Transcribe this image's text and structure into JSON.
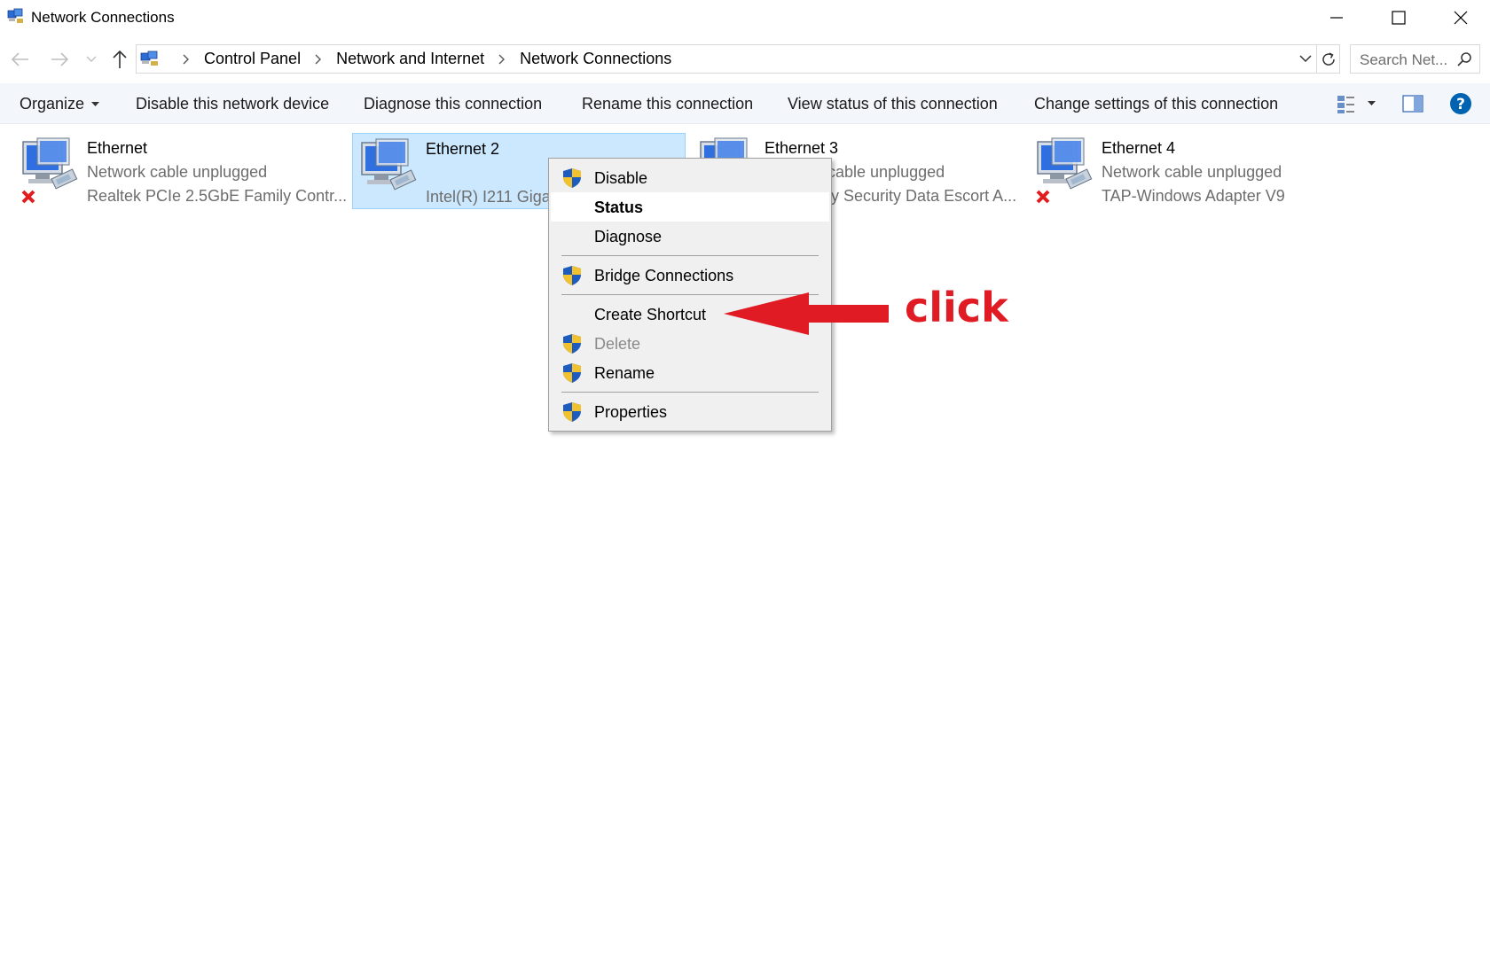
{
  "window": {
    "title": "Network Connections"
  },
  "address": {
    "breadcrumbs": [
      "Control Panel",
      "Network and Internet",
      "Network Connections"
    ],
    "search_placeholder": "Search Net..."
  },
  "commandbar": {
    "organize": "Organize",
    "disable": "Disable this network device",
    "diagnose": "Diagnose this connection",
    "rename": "Rename this connection",
    "view_status": "View status of this connection",
    "change_settings": "Change settings of this connection"
  },
  "connections": [
    {
      "name": "Ethernet",
      "status": "Network cable unplugged",
      "device": "Realtek PCIe 2.5GbE Family Contr...",
      "unplugged": true,
      "selected": false
    },
    {
      "name": "Ethernet 2",
      "status": "",
      "device": "Intel(R) I211 Gigabit Network Connection",
      "unplugged": false,
      "selected": true
    },
    {
      "name": "Ethernet 3",
      "status": "Network cable unplugged",
      "device": "Kaspersky Security Data Escort A...",
      "unplugged": true,
      "selected": false
    },
    {
      "name": "Ethernet 4",
      "status": "Network cable unplugged",
      "device": "TAP-Windows Adapter V9",
      "unplugged": true,
      "selected": false
    }
  ],
  "context_menu": {
    "items": [
      {
        "label": "Disable",
        "shield": true
      },
      {
        "label": "Status",
        "bold": true
      },
      {
        "label": "Diagnose"
      },
      {
        "label": "Bridge Connections",
        "shield": true
      },
      {
        "label": "Create Shortcut"
      },
      {
        "label": "Delete",
        "shield": true,
        "disabled": true
      },
      {
        "label": "Rename",
        "shield": true
      },
      {
        "label": "Properties",
        "shield": true
      }
    ]
  },
  "annotation": {
    "text": "click",
    "color": "#e01b24"
  },
  "colors": {
    "selection_bg": "#cce8ff",
    "commandbar_bg": "#f3f6fb",
    "help_blue": "#0063b1"
  }
}
